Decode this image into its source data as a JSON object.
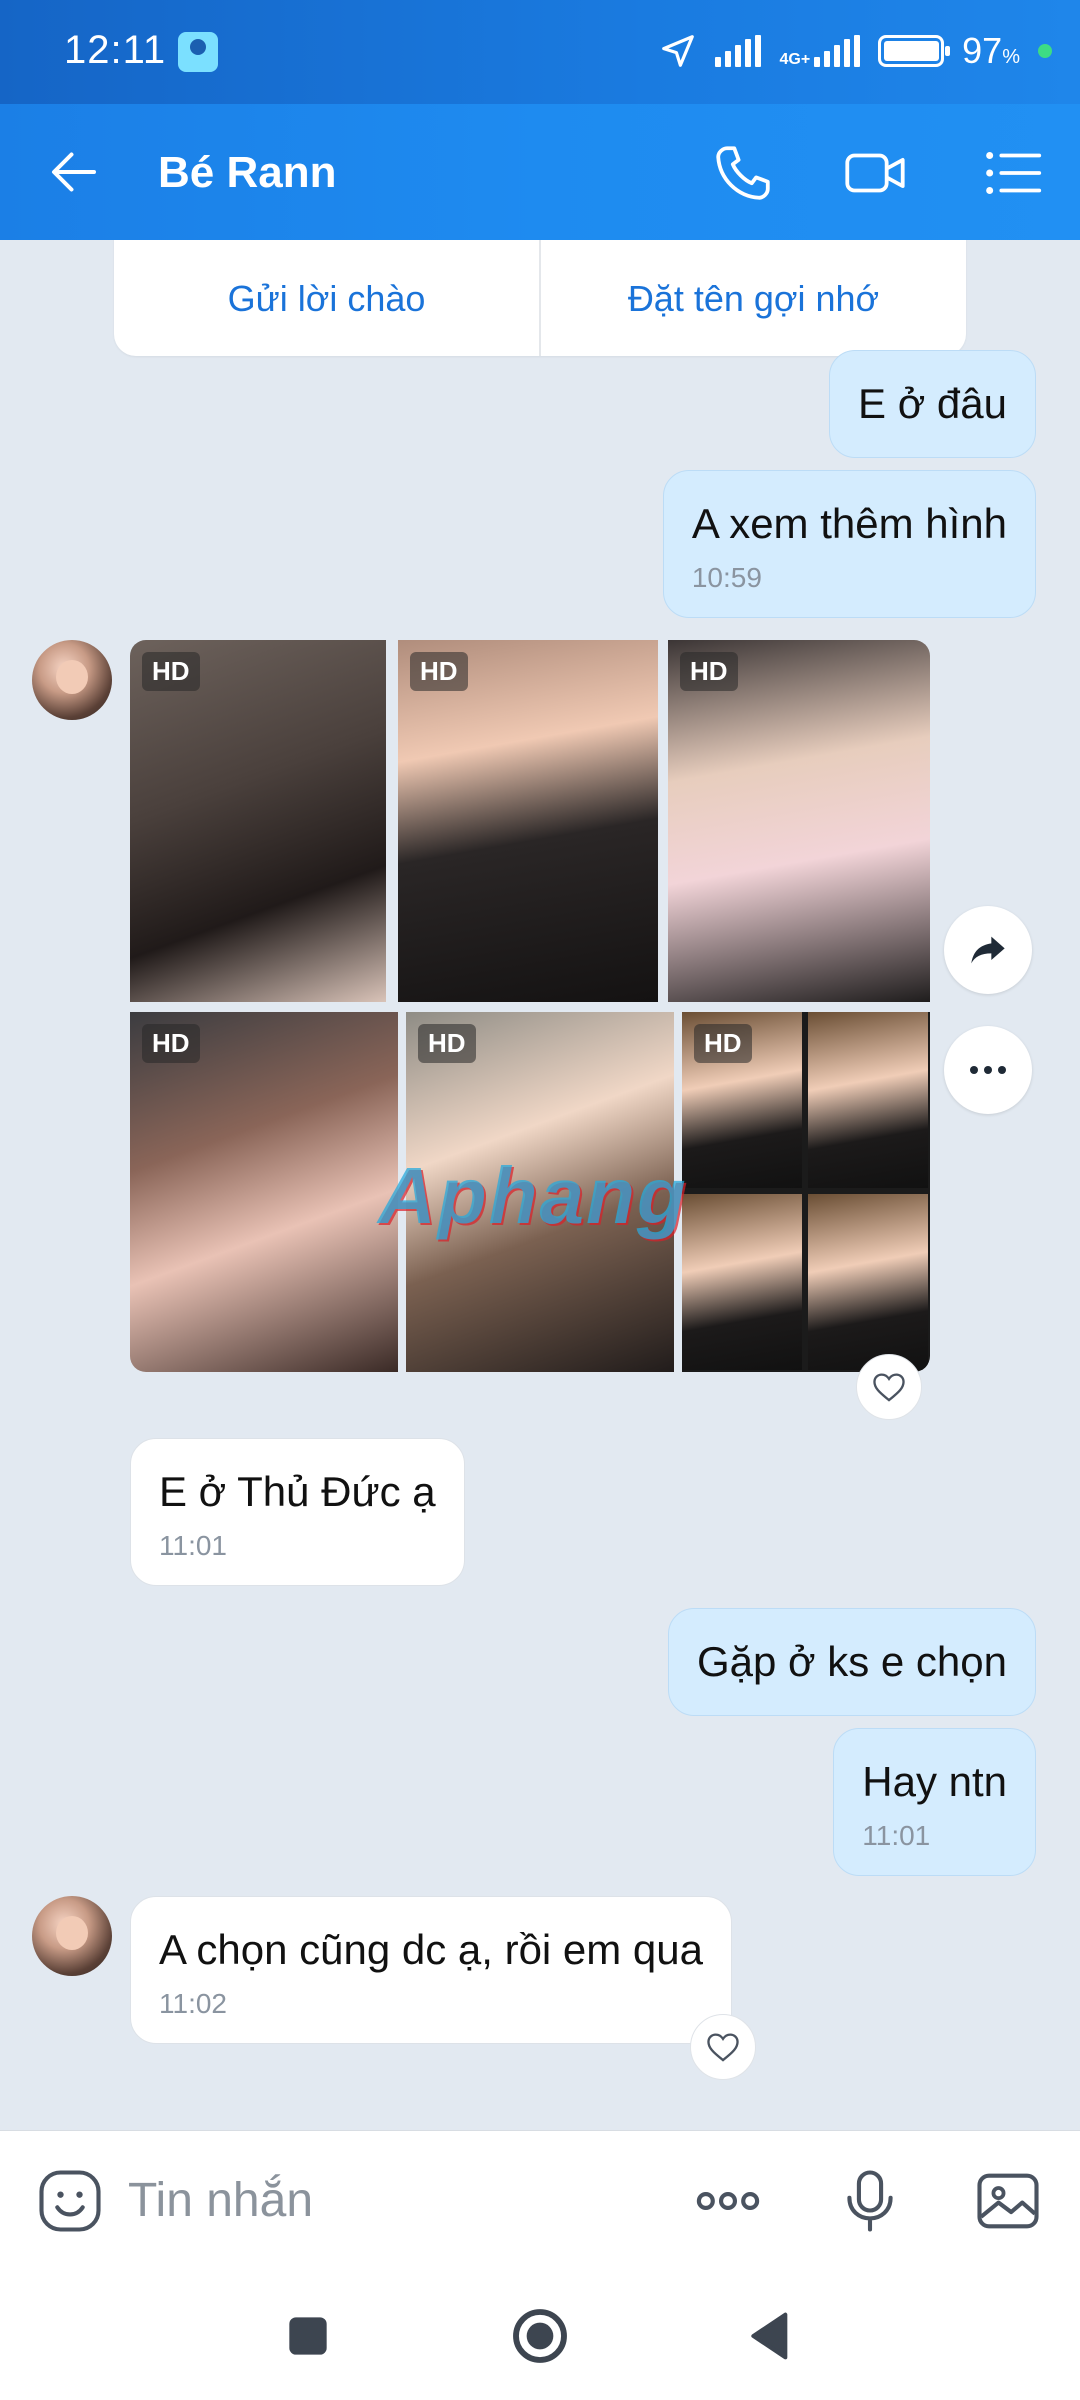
{
  "status_bar": {
    "time": "12:11",
    "network": "4G+",
    "battery_percent": "97",
    "battery_symbol": "%"
  },
  "header": {
    "title": "Bé Rann",
    "icons": [
      "back-arrow-icon",
      "phone-icon",
      "video-call-icon",
      "menu-list-icon"
    ]
  },
  "actions": {
    "greet_label": "Gửi lời chào",
    "nickname_label": "Đặt tên gợi nhớ"
  },
  "messages": [
    {
      "side": "me",
      "text": "E ở đâu",
      "time": ""
    },
    {
      "side": "me",
      "text": "A xem thêm hình",
      "time": "10:59"
    },
    {
      "side": "them",
      "text": "E ở Thủ Đức ạ",
      "time": "11:01"
    },
    {
      "side": "me",
      "text": "Gặp ở ks e chọn",
      "time": ""
    },
    {
      "side": "me",
      "text": "Hay ntn",
      "time": "11:01"
    },
    {
      "side": "them",
      "text": "A chọn cũng dc ạ, rồi em qua",
      "time": "11:02"
    }
  ],
  "photos": {
    "badge": "HD",
    "count": 6
  },
  "watermark": "Aphang",
  "input": {
    "placeholder": "Tin nhắn"
  },
  "colors": {
    "header": "#1e8bf0",
    "outgoing_bubble": "#d4ecfe",
    "incoming_bubble": "#ffffff",
    "background": "#e2e9f1",
    "accent_link": "#1a73d9"
  }
}
